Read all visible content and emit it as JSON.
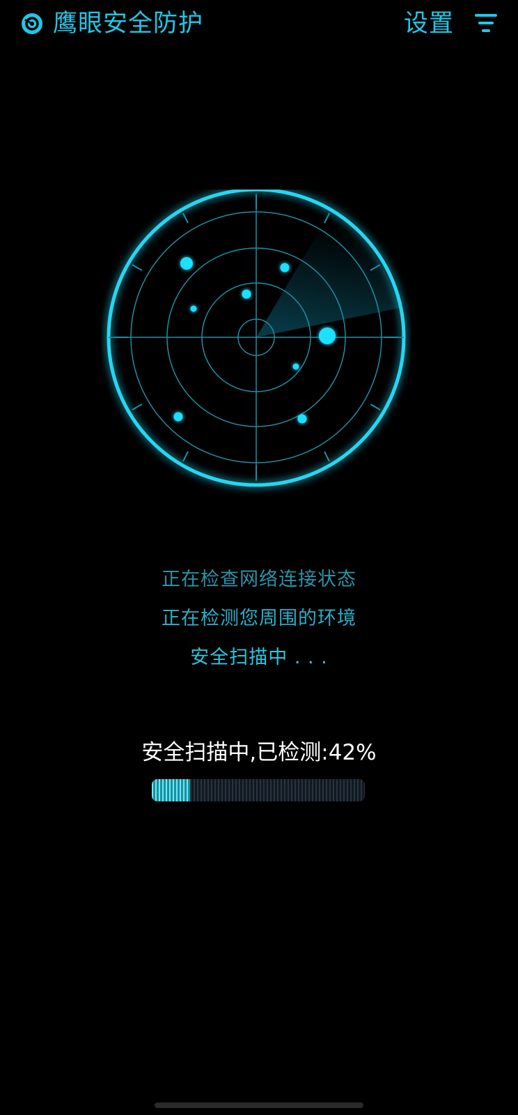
{
  "header": {
    "app_title": "鹰眼安全防护",
    "settings_label": "设置",
    "app_icon": "shield-eye-icon",
    "menu_icon": "filter-menu-icon"
  },
  "colors": {
    "accent": "#22d3ee",
    "background": "#000000",
    "text_primary": "#ffffff"
  },
  "status_lines": [
    "正在检查网络连接状态",
    "正在检测您周围的环境",
    "安全扫描中 . . ."
  ],
  "progress": {
    "label": "安全扫描中,已检测:42%",
    "value": 0.42
  }
}
